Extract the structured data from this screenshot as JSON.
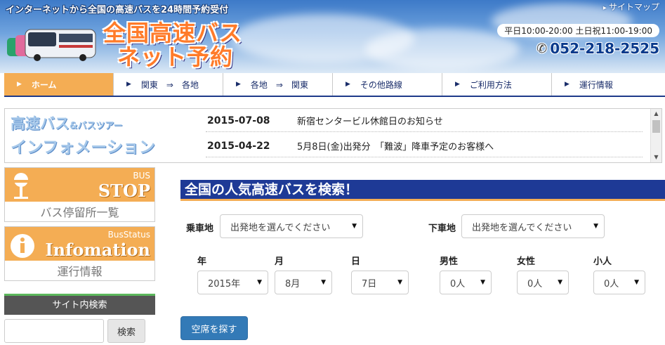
{
  "header": {
    "tagline": "インターネットから全国の高速バスを24時間予約受付",
    "sitemap_label": "サイトマップ",
    "logo_line1": "全国高速バス",
    "logo_line2": "ネット予約",
    "hours": "平日10:00-20:00 土日祝11:00-19:00",
    "phone": "052-218-2525"
  },
  "nav": {
    "items": [
      {
        "label": "ホーム"
      },
      {
        "label": "関東　⇒　各地"
      },
      {
        "label": "各地　⇒　関東"
      },
      {
        "label": "その他路線"
      },
      {
        "label": "ご利用方法"
      },
      {
        "label": "運行情報"
      }
    ]
  },
  "info": {
    "title_line1": "高速バス",
    "title_amp": "&バスツアー",
    "title_line2": "インフォメーション",
    "news": [
      {
        "date": "2015-07-08",
        "title": "新宿センタービル休館日のお知らせ"
      },
      {
        "date": "2015-04-22",
        "title": "5月8日(金)出発分　「難波」降車予定のお客様へ"
      }
    ]
  },
  "sidebar": {
    "bus_stop": {
      "small": "BUS",
      "big": "STOP",
      "caption": "バス停留所一覧"
    },
    "bus_status": {
      "small": "BusStatus",
      "big": "Infomation",
      "caption": "運行情報"
    },
    "site_search": {
      "heading": "サイト内検索",
      "button": "検索",
      "placeholder": ""
    }
  },
  "search": {
    "heading": "全国の人気高速バスを検索！",
    "board_label": "乗車地",
    "board_value": "出発地を選んでください",
    "alight_label": "下車地",
    "alight_value": "出発地を選んでください",
    "year_label": "年",
    "year_value": "2015年",
    "month_label": "月",
    "month_value": "8月",
    "day_label": "日",
    "day_value": "7日",
    "male_label": "男性",
    "male_value": "0人",
    "female_label": "女性",
    "female_value": "0人",
    "child_label": "小人",
    "child_value": "0人",
    "submit_label": "空席を探す"
  },
  "colors": {
    "nav_active": "#f4ad54",
    "brand_blue": "#1e3a96",
    "button_blue": "#337ab7",
    "logo_orange": "#ff7b2a"
  }
}
